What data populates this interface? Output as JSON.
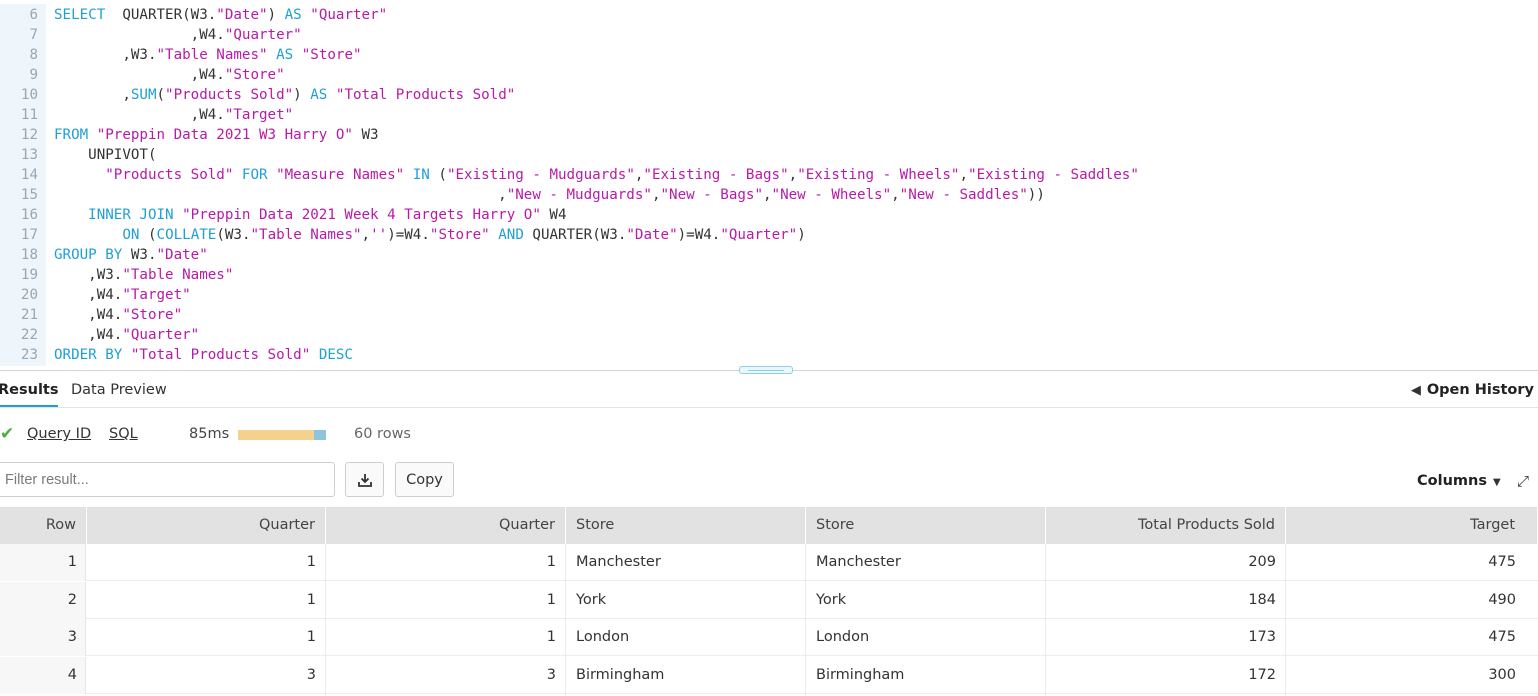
{
  "editor": {
    "lines": [
      {
        "n": "6",
        "tokens": [
          [
            "kw",
            "SELECT"
          ],
          [
            "pn",
            "  QUARTER(W3."
          ],
          [
            "st",
            "\"Date\""
          ],
          [
            "pn",
            ") "
          ],
          [
            "kw",
            "AS"
          ],
          [
            "pn",
            " "
          ],
          [
            "st",
            "\"Quarter\""
          ]
        ]
      },
      {
        "n": "7",
        "tokens": [
          [
            "pn",
            "                ,W4."
          ],
          [
            "st",
            "\"Quarter\""
          ]
        ]
      },
      {
        "n": "8",
        "tokens": [
          [
            "pn",
            "        ,W3."
          ],
          [
            "st",
            "\"Table Names\""
          ],
          [
            "pn",
            " "
          ],
          [
            "kw",
            "AS"
          ],
          [
            "pn",
            " "
          ],
          [
            "st",
            "\"Store\""
          ]
        ]
      },
      {
        "n": "9",
        "tokens": [
          [
            "pn",
            "                ,W4."
          ],
          [
            "st",
            "\"Store\""
          ]
        ]
      },
      {
        "n": "10",
        "tokens": [
          [
            "pn",
            "        ,"
          ],
          [
            "kw",
            "SUM"
          ],
          [
            "pn",
            "("
          ],
          [
            "st",
            "\"Products Sold\""
          ],
          [
            "pn",
            ") "
          ],
          [
            "kw",
            "AS"
          ],
          [
            "pn",
            " "
          ],
          [
            "st",
            "\"Total Products Sold\""
          ]
        ]
      },
      {
        "n": "11",
        "tokens": [
          [
            "pn",
            "                ,W4."
          ],
          [
            "st",
            "\"Target\""
          ]
        ]
      },
      {
        "n": "12",
        "tokens": [
          [
            "kw",
            "FROM"
          ],
          [
            "pn",
            " "
          ],
          [
            "st",
            "\"Preppin Data 2021 W3 Harry O\""
          ],
          [
            "pn",
            " W3"
          ]
        ]
      },
      {
        "n": "13",
        "tokens": [
          [
            "pn",
            "    UNPIVOT("
          ]
        ]
      },
      {
        "n": "14",
        "tokens": [
          [
            "pn",
            "      "
          ],
          [
            "st",
            "\"Products Sold\""
          ],
          [
            "pn",
            " "
          ],
          [
            "kw",
            "FOR"
          ],
          [
            "pn",
            " "
          ],
          [
            "st",
            "\"Measure Names\""
          ],
          [
            "pn",
            " "
          ],
          [
            "kw",
            "IN"
          ],
          [
            "pn",
            " ("
          ],
          [
            "st",
            "\"Existing - Mudguards\""
          ],
          [
            "pn",
            ","
          ],
          [
            "st",
            "\"Existing - Bags\""
          ],
          [
            "pn",
            ","
          ],
          [
            "st",
            "\"Existing - Wheels\""
          ],
          [
            "pn",
            ","
          ],
          [
            "st",
            "\"Existing - Saddles\""
          ]
        ]
      },
      {
        "n": "15",
        "tokens": [
          [
            "pn",
            "                                                    ,"
          ],
          [
            "st",
            "\"New - Mudguards\""
          ],
          [
            "pn",
            ","
          ],
          [
            "st",
            "\"New - Bags\""
          ],
          [
            "pn",
            ","
          ],
          [
            "st",
            "\"New - Wheels\""
          ],
          [
            "pn",
            ","
          ],
          [
            "st",
            "\"New - Saddles\""
          ],
          [
            "pn",
            "))"
          ]
        ]
      },
      {
        "n": "16",
        "tokens": [
          [
            "pn",
            "    "
          ],
          [
            "kw",
            "INNER JOIN"
          ],
          [
            "pn",
            " "
          ],
          [
            "st",
            "\"Preppin Data 2021 Week 4 Targets Harry O\""
          ],
          [
            "pn",
            " W4"
          ]
        ]
      },
      {
        "n": "17",
        "tokens": [
          [
            "pn",
            "        "
          ],
          [
            "kw",
            "ON"
          ],
          [
            "pn",
            " ("
          ],
          [
            "kw",
            "COLLATE"
          ],
          [
            "pn",
            "(W3."
          ],
          [
            "st",
            "\"Table Names\""
          ],
          [
            "pn",
            ","
          ],
          [
            "st",
            "''"
          ],
          [
            "pn",
            ")=W4."
          ],
          [
            "st",
            "\"Store\""
          ],
          [
            "pn",
            " "
          ],
          [
            "kw",
            "AND"
          ],
          [
            "pn",
            " QUARTER(W3."
          ],
          [
            "st",
            "\"Date\""
          ],
          [
            "pn",
            ")=W4."
          ],
          [
            "st",
            "\"Quarter\""
          ],
          [
            "pn",
            ")"
          ]
        ]
      },
      {
        "n": "18",
        "tokens": [
          [
            "kw",
            "GROUP BY"
          ],
          [
            "pn",
            " W3."
          ],
          [
            "st",
            "\"Date\""
          ]
        ]
      },
      {
        "n": "19",
        "tokens": [
          [
            "pn",
            "    ,W3."
          ],
          [
            "st",
            "\"Table Names\""
          ]
        ]
      },
      {
        "n": "20",
        "tokens": [
          [
            "pn",
            "    ,W4."
          ],
          [
            "st",
            "\"Target\""
          ]
        ]
      },
      {
        "n": "21",
        "tokens": [
          [
            "pn",
            "    ,W4."
          ],
          [
            "st",
            "\"Store\""
          ]
        ]
      },
      {
        "n": "22",
        "tokens": [
          [
            "pn",
            "    ,W4."
          ],
          [
            "st",
            "\"Quarter\""
          ]
        ]
      },
      {
        "n": "23",
        "tokens": [
          [
            "kw",
            "ORDER BY"
          ],
          [
            "pn",
            " "
          ],
          [
            "st",
            "\"Total Products Sold\""
          ],
          [
            "pn",
            " "
          ],
          [
            "kw",
            "DESC"
          ]
        ]
      }
    ]
  },
  "tabs": {
    "results": "Results",
    "data_preview": "Data Preview",
    "open_history": "Open History"
  },
  "query_info": {
    "query_id": "Query ID",
    "sql": "SQL",
    "duration": "85ms",
    "rows": "60 rows"
  },
  "toolbar": {
    "filter_placeholder": "Filter result...",
    "copy": "Copy",
    "columns": "Columns"
  },
  "table": {
    "headers": [
      "Row",
      "Quarter",
      "Quarter",
      "Store",
      "Store",
      "Total Products Sold",
      "Target"
    ],
    "rows": [
      [
        "1",
        "1",
        "1",
        "Manchester",
        "Manchester",
        "209",
        "475"
      ],
      [
        "2",
        "1",
        "1",
        "York",
        "York",
        "184",
        "490"
      ],
      [
        "3",
        "1",
        "1",
        "London",
        "London",
        "173",
        "475"
      ],
      [
        "4",
        "3",
        "3",
        "Birmingham",
        "Birmingham",
        "172",
        "300"
      ]
    ]
  },
  "colors": {
    "keyword": "#1e9fd8",
    "string": "#b81aa8",
    "success": "#4caf3d",
    "accent": "#1e9fd8"
  },
  "icons": {
    "status": "check-icon",
    "history": "arrow-left-icon",
    "download": "download-icon",
    "columns": "caret-down-icon",
    "expand": "expand-icon"
  }
}
